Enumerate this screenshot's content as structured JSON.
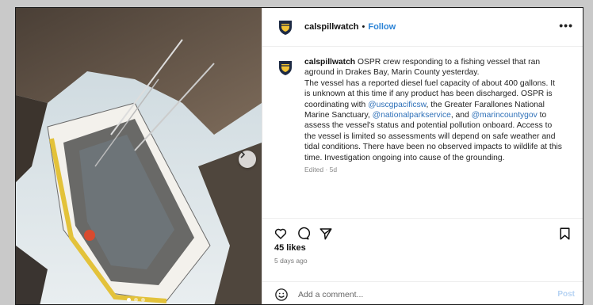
{
  "post": {
    "username": "calspillwatch",
    "follow_label": "Follow",
    "bullet": "•",
    "more_label": "•••",
    "caption": {
      "username": "calspillwatch",
      "text_1": " OSPR crew responding to a fishing vessel that ran aground in Drakes Bay, Marin County yesterday.",
      "text_2": "The vessel has a reported diesel fuel capacity of about 400 gallons. It is unknown at this time if any product has been discharged. OSPR is coordinating with ",
      "mention_1": "@uscgpacificsw",
      "text_3": ", the Greater Farallones National Marine Sanctuary, ",
      "mention_2": "@nationalparkservice",
      "text_4": ", and ",
      "mention_3": "@marincountygov",
      "text_5": " to assess the vessel's status and potential pollution onboard. Access to the vessel is limited so assessments will depend on safe weather and tidal conditions. There have been no observed impacts to wildlife at this time. Investigation ongoing into cause of the grounding."
    },
    "edited": "Edited · 5d",
    "likes": "45 likes",
    "time_ago": "5 days ago",
    "comment_placeholder": "Add a comment...",
    "post_label": "Post",
    "carousel": {
      "total": 3,
      "active": 1
    }
  },
  "icons": {
    "avatar": "ospr-badge-icon",
    "like": "heart-icon",
    "comment": "comment-bubble-icon",
    "share": "paper-plane-icon",
    "save": "bookmark-icon",
    "emoji": "smiley-icon",
    "next": "chevron-right-icon"
  },
  "colors": {
    "link": "#2b83d6",
    "mention": "#2e70b8",
    "post_disabled": "#b6d3f3"
  }
}
